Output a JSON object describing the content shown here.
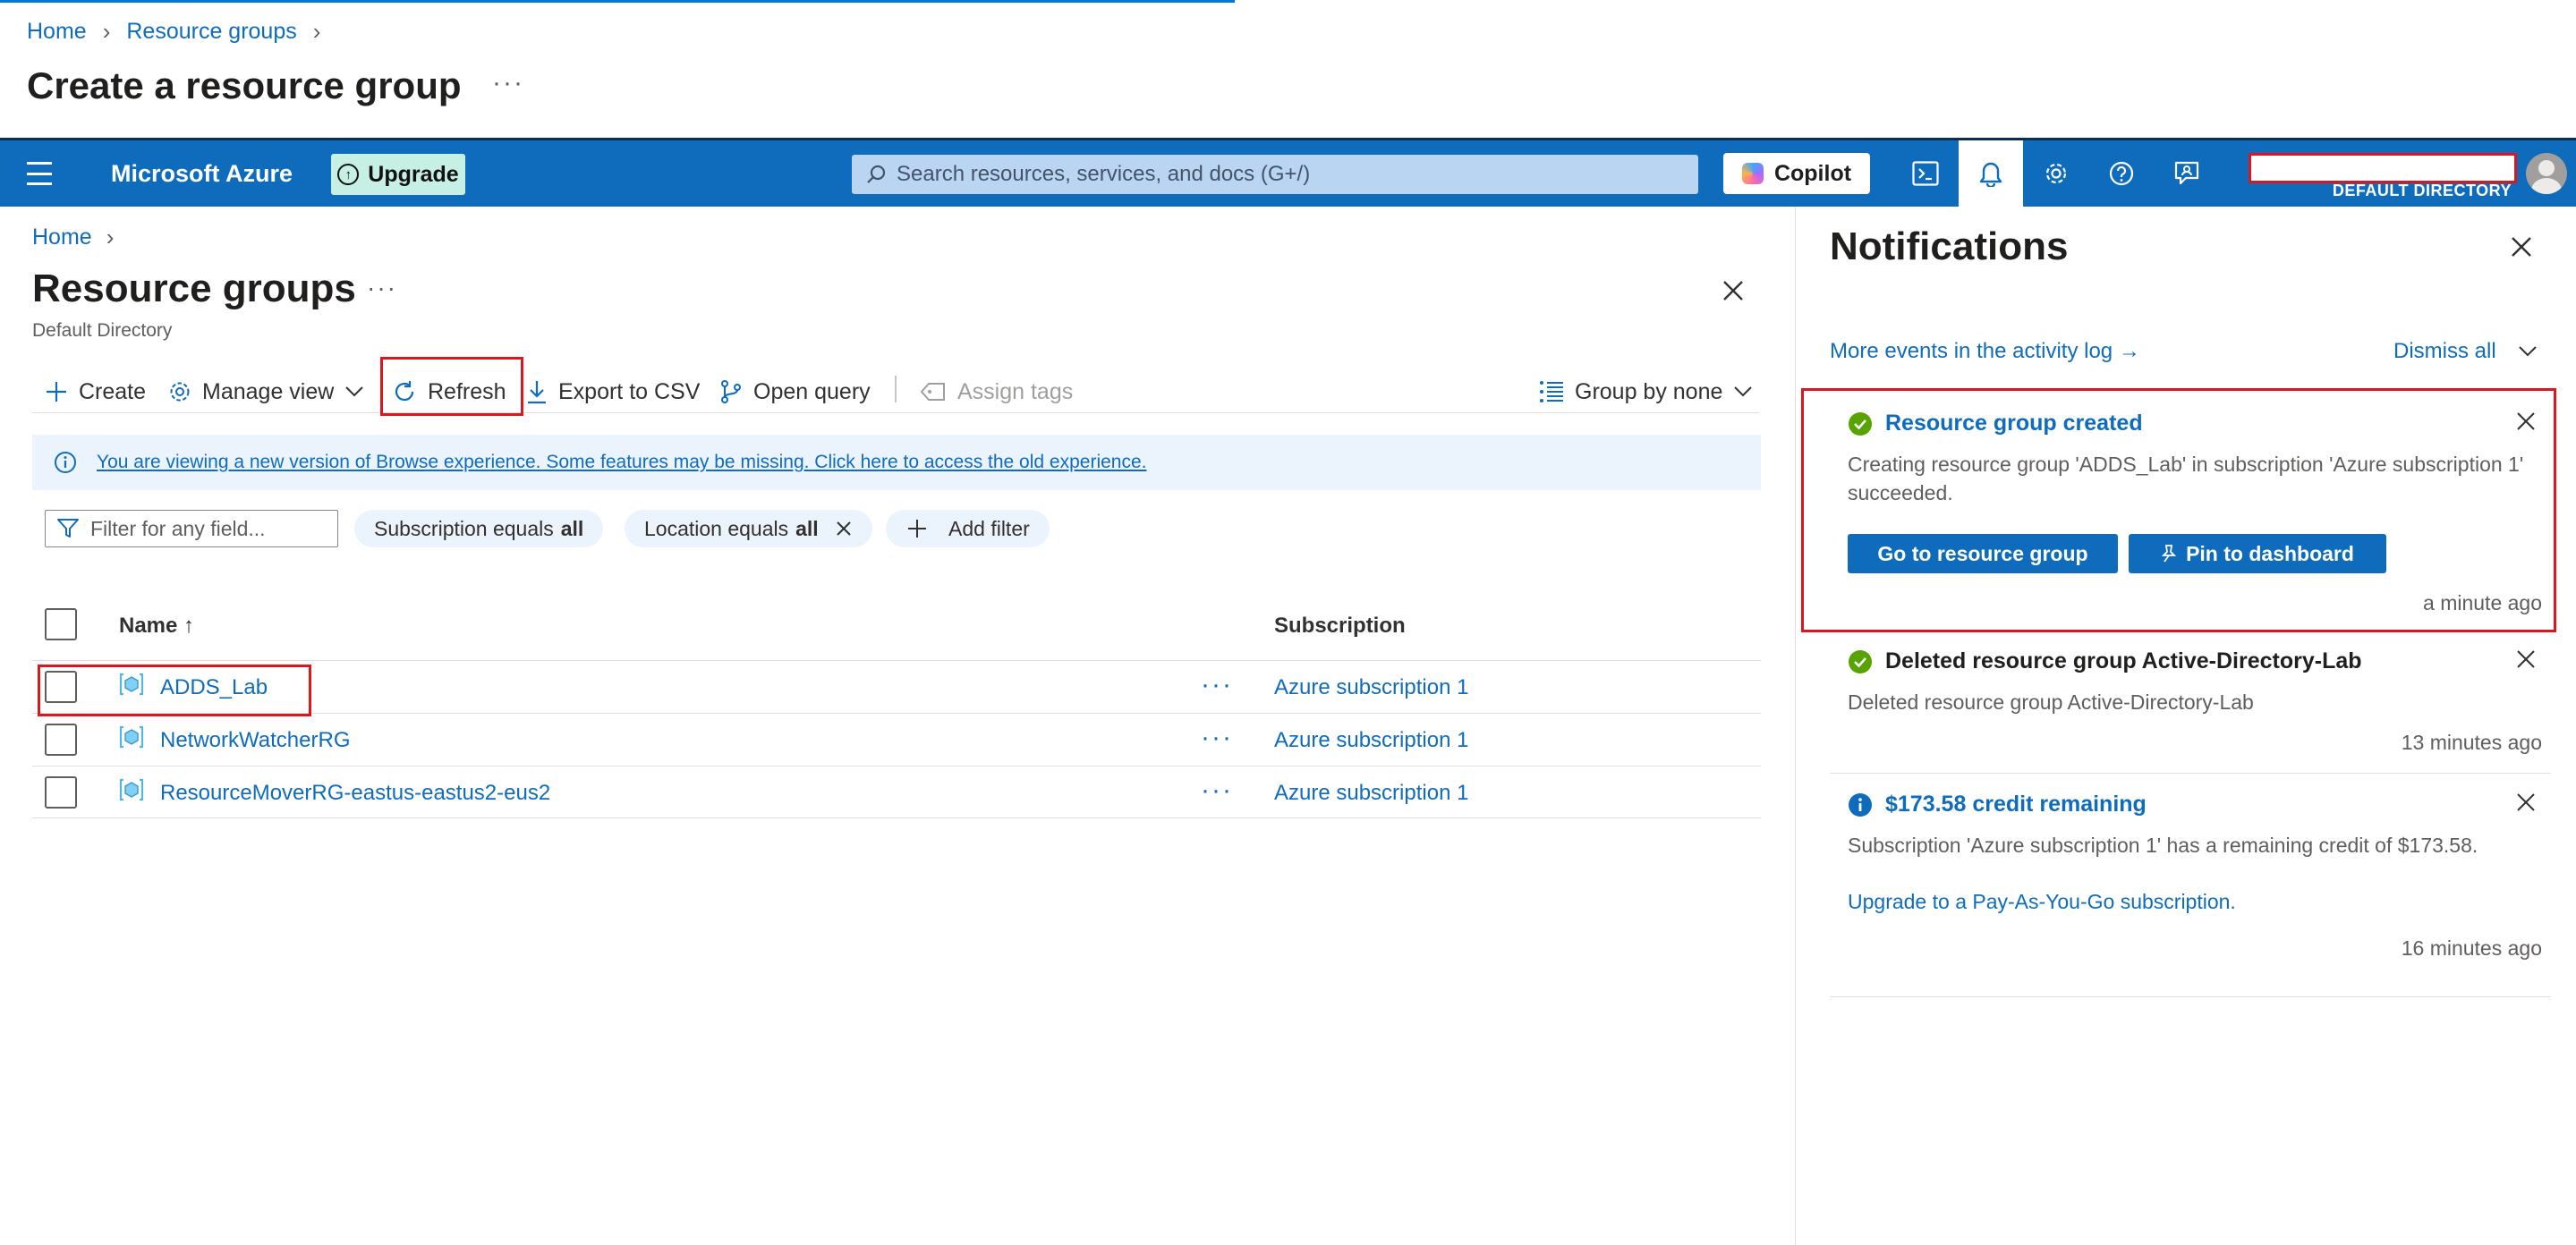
{
  "outer": {
    "breadcrumb": [
      "Home",
      "Resource groups"
    ],
    "title": "Create a resource group",
    "more": "···"
  },
  "topbar": {
    "brand": "Microsoft Azure",
    "upgrade_label": "Upgrade",
    "search_placeholder": "Search resources, services, and docs (G+/)",
    "copilot_label": "Copilot",
    "directory_label": "DEFAULT DIRECTORY",
    "icons": [
      "cloud-shell-icon",
      "bell-icon",
      "gear-icon",
      "help-icon",
      "feedback-icon"
    ]
  },
  "blade": {
    "breadcrumb_home": "Home",
    "title": "Resource groups",
    "more": "···",
    "subtitle": "Default Directory",
    "commands": {
      "create": "Create",
      "manage_view": "Manage view",
      "refresh": "Refresh",
      "export_csv": "Export to CSV",
      "open_query": "Open query",
      "assign_tags": "Assign tags",
      "group_by": "Group by none"
    },
    "info_text": "You are viewing a new version of Browse experience. Some features may be missing. Click here to access the old experience.",
    "filter_placeholder": "Filter for any field...",
    "pills": {
      "subscription_prefix": "Subscription equals",
      "subscription_value": "all",
      "location_prefix": "Location equals",
      "location_value": "all",
      "add_filter": "Add filter"
    },
    "table": {
      "col_name": "Name ↑",
      "col_subscription": "Subscription",
      "rows": [
        {
          "name": "ADDS_Lab",
          "subscription": "Azure subscription 1"
        },
        {
          "name": "NetworkWatcherRG",
          "subscription": "Azure subscription 1"
        },
        {
          "name": "ResourceMoverRG-eastus-eastus2-eus2",
          "subscription": "Azure subscription 1"
        }
      ],
      "row_actions": "···"
    }
  },
  "notifications": {
    "title": "Notifications",
    "activity_link": "More events in the activity log →",
    "dismiss_all": "Dismiss all",
    "items": [
      {
        "title": "Resource group created",
        "body": "Creating resource group 'ADDS_Lab' in subscription 'Azure subscription 1' succeeded.",
        "button1": "Go to resource group",
        "button2": "Pin to dashboard",
        "time": "a minute ago"
      },
      {
        "title": "Deleted resource group Active-Directory-Lab",
        "body": "Deleted resource group Active-Directory-Lab",
        "time": "13 minutes ago"
      },
      {
        "title": "$173.58 credit remaining",
        "body": "Subscription 'Azure subscription 1' has a remaining credit of $173.58.",
        "link": "Upgrade to a Pay-As-You-Go subscription.",
        "time": "16 minutes ago"
      }
    ]
  },
  "colors": {
    "azure_blue": "#0f6cbd",
    "highlight_red": "#d8171e",
    "success_green": "#57a300"
  }
}
